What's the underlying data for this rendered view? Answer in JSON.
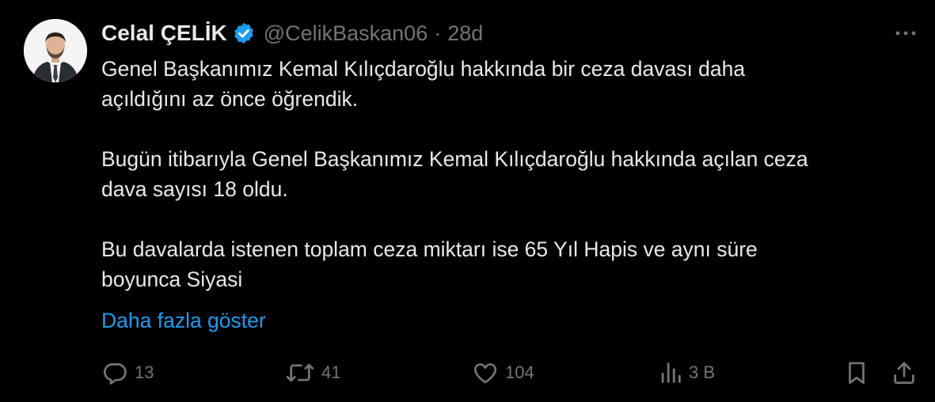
{
  "author": {
    "display_name": "Celal ÇELİK",
    "handle": "@CelikBaskan06",
    "separator": "·",
    "time": "28d",
    "verified_color": "#1d9bf0"
  },
  "tweet": {
    "paragraphs": [
      "Genel Başkanımız Kemal Kılıçdaroğlu hakkında bir ceza davası daha\naçıldığını az önce öğrendik.",
      "Bugün itibarıyla Genel Başkanımız Kemal Kılıçdaroğlu hakkında açılan ceza\ndava sayısı 18 oldu.",
      "Bu davalarda istenen toplam ceza miktarı ise 65 Yıl Hapis ve aynı süre\nboyunca Siyasi"
    ],
    "show_more_label": "Daha fazla göster",
    "link_color": "#1d9bf0"
  },
  "actions": {
    "replies": "13",
    "retweets": "41",
    "likes": "104",
    "views": "3 B"
  },
  "icons": {
    "more": "more-horizontal-icon",
    "reply": "reply-icon",
    "retweet": "retweet-icon",
    "like": "heart-icon",
    "views": "analytics-icon",
    "bookmark": "bookmark-icon",
    "share": "share-icon"
  },
  "colors": {
    "background": "#000000",
    "text": "#e7e9ea",
    "secondary": "#71767b"
  }
}
